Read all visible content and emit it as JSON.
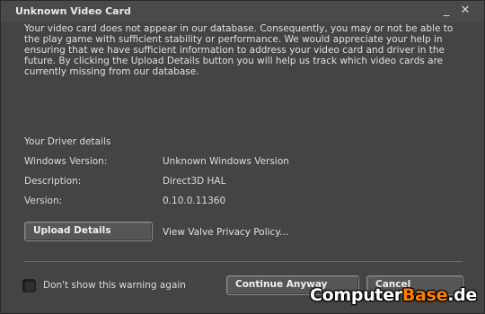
{
  "window": {
    "title": "Unknown Video Card",
    "minimize_glyph": "_",
    "close_glyph": "✕"
  },
  "intro_text": "Your video card does not appear in our database. Consequently, you may or not be able to the play game with sufficient stability or performance. We would appreciate your help in ensuring that we have sufficient information to address your video card and driver in the future. By clicking the Upload Details button you will help us track which video cards are currently missing from our database.",
  "driver": {
    "heading": "Your Driver details",
    "rows": [
      {
        "label": "Windows Version:",
        "value": "Unknown Windows Version"
      },
      {
        "label": "Description:",
        "value": "Direct3D HAL"
      },
      {
        "label": "Version:",
        "value": "0.10.0.11360"
      }
    ]
  },
  "actions": {
    "upload_label": "Upload Details",
    "privacy_link": "View Valve Privacy Policy...",
    "dont_show_label": "Don't show this warning again",
    "dont_show_checked": false,
    "continue_label": "Continue Anyway",
    "cancel_label": "Cancel"
  },
  "watermark": {
    "part1": "Computer",
    "part2": "Base",
    "part3": ".de",
    "accent_color": "#ff8000"
  },
  "colors": {
    "background": "#444444",
    "text": "#dcdcdc"
  }
}
